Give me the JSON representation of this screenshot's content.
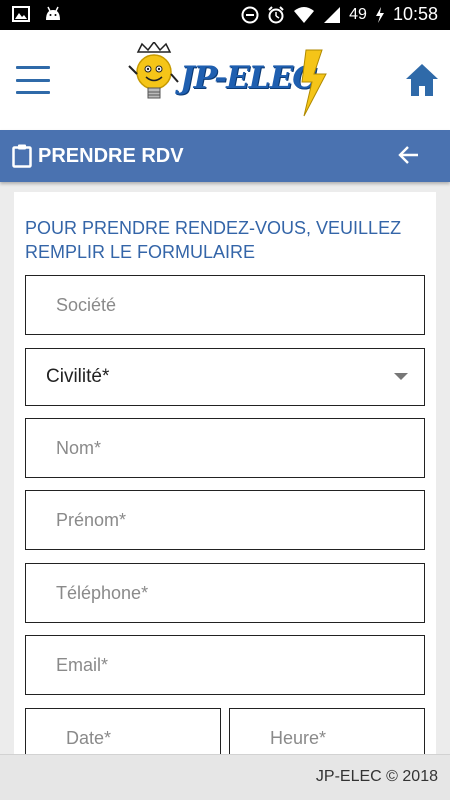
{
  "status_bar": {
    "battery": "49",
    "time": "10:58",
    "icons": [
      "image-icon",
      "android-icon",
      "do-not-disturb-icon",
      "alarm-icon",
      "wifi-icon",
      "signal-icon",
      "battery-charging-icon"
    ]
  },
  "header": {
    "logo_text": "JP-ELEC",
    "menu_icon": "hamburger-menu-icon",
    "home_icon": "home-icon"
  },
  "titlebar": {
    "title": "PRENDRE RDV",
    "icon": "clipboard-icon",
    "back_icon": "arrow-back-icon"
  },
  "form": {
    "heading": "POUR PRENDRE RENDEZ-VOUS, VEUILLEZ REMPLIR LE FORMULAIRE",
    "societe_placeholder": "Société",
    "civilite_value": "Civilité*",
    "nom_placeholder": "Nom*",
    "prenom_placeholder": "Prénom*",
    "telephone_placeholder": "Téléphone*",
    "email_placeholder": "Email*",
    "date_placeholder": "Date*",
    "heure_placeholder": "Heure*"
  },
  "footer": {
    "text": "JP-ELEC © 2018"
  },
  "colors": {
    "brand_blue": "#4a72b0",
    "heading_blue": "#3465a8",
    "logo_yellow": "#f5c518"
  }
}
